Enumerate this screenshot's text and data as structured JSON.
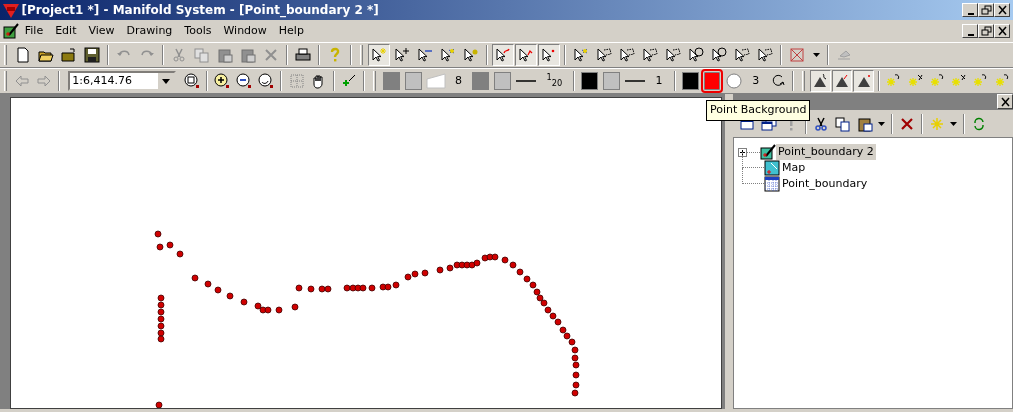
{
  "window": {
    "title": "[Project1 *] - Manifold System - [Point_boundary 2 *]"
  },
  "menu": [
    "File",
    "Edit",
    "View",
    "Drawing",
    "Tools",
    "Window",
    "Help"
  ],
  "select_tools": [
    {
      "selected": true
    },
    {
      "selected": false
    },
    {
      "selected": false
    },
    {
      "selected": false
    },
    {
      "selected": false
    }
  ],
  "selection_modes": [
    {
      "selected": true
    },
    {
      "selected": true
    },
    {
      "selected": true
    }
  ],
  "scale_field": {
    "value": "1:6,414.76"
  },
  "style_items": [
    {
      "kind": "swatch",
      "color": "#808080",
      "highlighted": false
    },
    {
      "kind": "swatch",
      "color": "#c0c0c0",
      "highlighted": false
    },
    {
      "kind": "wedge"
    },
    {
      "kind": "text",
      "text": "8"
    },
    {
      "kind": "swatch",
      "color": "#808080",
      "highlighted": false
    },
    {
      "kind": "swatch",
      "color": "#c0c0c0",
      "highlighted": false
    },
    {
      "kind": "line"
    },
    {
      "kind": "text",
      "text": "$^{1}$$_{20}$"
    },
    {
      "kind": "sep"
    },
    {
      "kind": "swatch",
      "color": "#000000",
      "highlighted": false
    },
    {
      "kind": "swatch",
      "color": "#c0c0c0",
      "highlighted": false
    },
    {
      "kind": "line"
    },
    {
      "kind": "text",
      "text": "1"
    },
    {
      "kind": "sep"
    },
    {
      "kind": "swatch",
      "color": "#000000",
      "highlighted": false
    },
    {
      "kind": "swatch",
      "color": "#ff0000",
      "highlighted": true
    },
    {
      "kind": "circle"
    },
    {
      "kind": "text",
      "text": "3"
    }
  ],
  "point_modes": [
    {
      "selected": true
    },
    {
      "selected": true
    },
    {
      "selected": true
    }
  ],
  "tooltip": "Point Background",
  "project_tree": [
    {
      "kind": "drawing",
      "label": "Point_boundary 2",
      "selected": true,
      "expanded": false
    },
    {
      "kind": "map",
      "label": "Map",
      "selected": false
    },
    {
      "kind": "table",
      "label": "Point_boundary",
      "selected": false
    }
  ]
}
